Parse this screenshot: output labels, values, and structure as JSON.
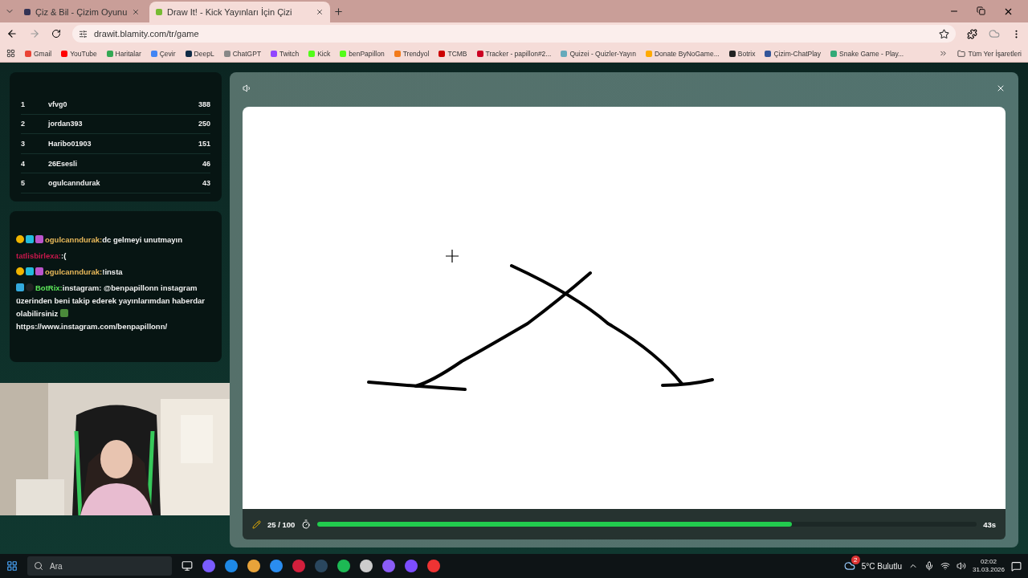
{
  "browser": {
    "tabs": [
      {
        "title": "Çiz & Bil - Çizim Oyunu",
        "selected": false
      },
      {
        "title": "Draw It! - Kick Yayınları İçin Çizi",
        "selected": true
      }
    ],
    "url": "drawit.blamity.com/tr/game",
    "bookmarks": [
      "Gmail",
      "YouTube",
      "Haritalar",
      "Çevir",
      "DeepL",
      "ChatGPT",
      "Twitch",
      "Kick",
      "benPapillon",
      "Trendyol",
      "TCMB",
      "Tracker - papillon#2...",
      "Quizei - Quizler-Yayın",
      "Donate ByNoGame...",
      "Botrix",
      "Çizim-ChatPlay",
      "Snake Game - Play..."
    ],
    "all_bookmarks": "Tüm Yer İşaretleri"
  },
  "leaderboard": [
    {
      "rank": "1",
      "name": "vfvg0",
      "score": "388"
    },
    {
      "rank": "2",
      "name": "jordan393",
      "score": "250"
    },
    {
      "rank": "3",
      "name": "Haribo01903",
      "score": "151"
    },
    {
      "rank": "4",
      "name": "26Esesli",
      "score": "46"
    },
    {
      "rank": "5",
      "name": "ogulcanndurak",
      "score": "43"
    }
  ],
  "chat": [
    {
      "user": "ogulcanndurak:",
      "color": "#e8b85a",
      "badges": true,
      "bot": false,
      "text": "dc gelmeyi unutmayın"
    },
    {
      "user": "tatlisbirlexa:",
      "color": "#c8184c",
      "badges": false,
      "bot": false,
      "text": ":("
    },
    {
      "user": "ogulcanndurak:",
      "color": "#e8b85a",
      "badges": true,
      "bot": false,
      "text": "!insta"
    },
    {
      "user": "BotRix:",
      "color": "#5de85a",
      "badges": false,
      "bot": true,
      "text": "instagram: @benpapillonn instagram",
      "more_lines": [
        "üzerinden beni takip ederek yayınlarımdan haberdar",
        "olabilirsiniz"
      ],
      "link": "https://www.instagram.com/benpapillonn/"
    }
  ],
  "game": {
    "progress": "25 / 100",
    "time_bar": {
      "level": 0.72
    },
    "time_left": "43s"
  },
  "taskbar": {
    "search_placeholder": "Ara",
    "weather": "5°C  Bulutlu",
    "weather_badge": "2",
    "time": "02:02",
    "date": "31.03.2026"
  }
}
